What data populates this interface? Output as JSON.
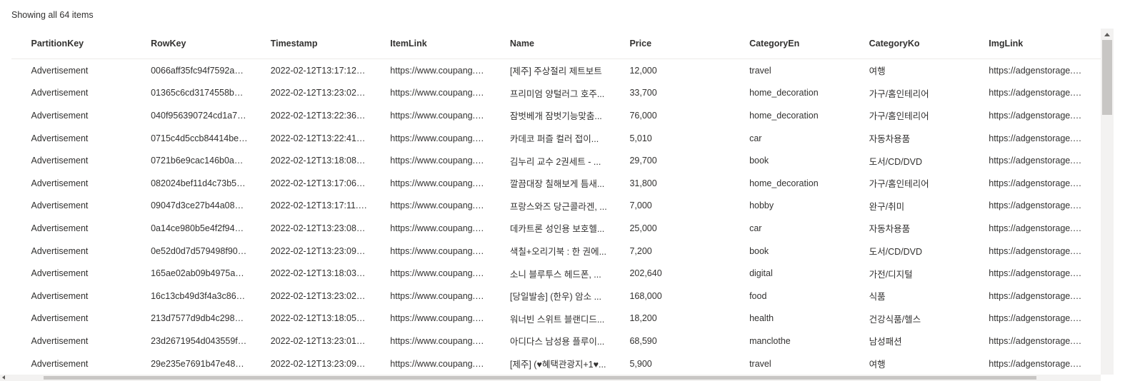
{
  "status_text": "Showing all 64 items",
  "table": {
    "columns": [
      "PartitionKey",
      "RowKey",
      "Timestamp",
      "ItemLink",
      "Name",
      "Price",
      "CategoryEn",
      "CategoryKo",
      "ImgLink"
    ],
    "rows": [
      [
        "Advertisement",
        "0066aff35fc94f7592a37...",
        "2022-02-12T13:17:12.68...",
        "https://www.coupang.co...",
        "[제주] 주상절리 제트보트",
        "12,000",
        "travel",
        "여행",
        "https://adgenstorage.bl..."
      ],
      [
        "Advertisement",
        "01365c6cd3174558bacc...",
        "2022-02-12T13:23:02.56...",
        "https://www.coupang.co...",
        "프리미엄 양털러그 호주...",
        "33,700",
        "home_decoration",
        "가구/홈인테리어",
        "https://adgenstorage.bl..."
      ],
      [
        "Advertisement",
        "040f956390724cd1a719...",
        "2022-02-12T13:22:36.22...",
        "https://www.coupang.co...",
        "잠벗베개 잠벗기능맞춤...",
        "76,000",
        "home_decoration",
        "가구/홈인테리어",
        "https://adgenstorage.bl..."
      ],
      [
        "Advertisement",
        "0715c4d5ccb84414be4a...",
        "2022-02-12T13:22:41.20...",
        "https://www.coupang.co...",
        "카데코 퍼즐 컬러 접이...",
        "5,010",
        "car",
        "자동차용품",
        "https://adgenstorage.bl..."
      ],
      [
        "Advertisement",
        "0721b6e9cac146b0a486...",
        "2022-02-12T13:18:08.10...",
        "https://www.coupang.co...",
        "김누리 교수 2권세트 - ...",
        "29,700",
        "book",
        "도서/CD/DVD",
        "https://adgenstorage.bl..."
      ],
      [
        "Advertisement",
        "082024bef11d4c73b5ba...",
        "2022-02-12T13:17:06.64...",
        "https://www.coupang.co...",
        "깔끔대장 칠해보게 틈새...",
        "31,800",
        "home_decoration",
        "가구/홈인테리어",
        "https://adgenstorage.bl..."
      ],
      [
        "Advertisement",
        "09047d3ce27b44a08db...",
        "2022-02-12T13:17:11.13...",
        "https://www.coupang.co...",
        "프랑스와즈 당근콜라겐, ...",
        "7,000",
        "hobby",
        "완구/취미",
        "https://adgenstorage.bl..."
      ],
      [
        "Advertisement",
        "0a14ce980b5e4f2f941e0...",
        "2022-02-12T13:23:08.54...",
        "https://www.coupang.co...",
        "데카트론 성인용 보호헬...",
        "25,000",
        "car",
        "자동차용품",
        "https://adgenstorage.bl..."
      ],
      [
        "Advertisement",
        "0e52d0d7d579498f90f4...",
        "2022-02-12T13:23:09.06...",
        "https://www.coupang.co...",
        "색칠+오리기북 : 한 권에...",
        "7,200",
        "book",
        "도서/CD/DVD",
        "https://adgenstorage.bl..."
      ],
      [
        "Advertisement",
        "165ae02ab09b4975a969...",
        "2022-02-12T13:18:03.14...",
        "https://www.coupang.co...",
        "소니 블루투스 헤드폰, ...",
        "202,640",
        "digital",
        "가전/디지털",
        "https://adgenstorage.bl..."
      ],
      [
        "Advertisement",
        "16c13cb49d3f4a3c8621...",
        "2022-02-12T13:23:02.08...",
        "https://www.coupang.co...",
        "[당일발송] (한우) 암소 ...",
        "168,000",
        "food",
        "식품",
        "https://adgenstorage.bl..."
      ],
      [
        "Advertisement",
        "213d7577d9db4c298a0...",
        "2022-02-12T13:18:05.62...",
        "https://www.coupang.co...",
        "워너빈 스위트 블랜디드...",
        "18,200",
        "health",
        "건강식품/헬스",
        "https://adgenstorage.bl..."
      ],
      [
        "Advertisement",
        "23d2671954d043559fd1...",
        "2022-02-12T13:23:01.57...",
        "https://www.coupang.co...",
        "아디다스 남성용 플루이...",
        "68,590",
        "manclothe",
        "남성패션",
        "https://adgenstorage.bl..."
      ],
      [
        "Advertisement",
        "29e235e7691b47e48eab...",
        "2022-02-12T13:23:09.55...",
        "https://www.coupang.co...",
        "[제주] (♥혜택관광지+1♥...",
        "5,900",
        "travel",
        "여행",
        "https://adgenstorage.bl..."
      ]
    ]
  }
}
